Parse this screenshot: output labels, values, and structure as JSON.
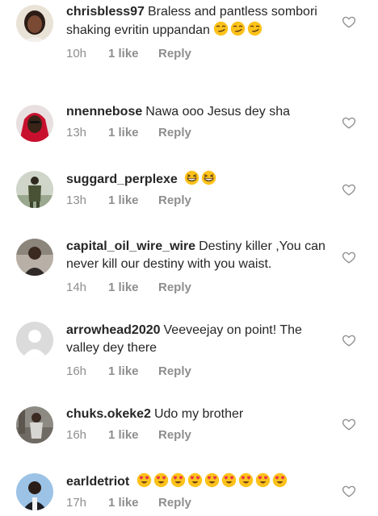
{
  "comments": [
    {
      "username": "chrisbless97",
      "text": "Braless and pantless sombori shaking evritin uppandan",
      "emoji_icon": "smirking-face-icon",
      "emoji_count": 3,
      "time": "10h",
      "likes": "1 like",
      "reply_label": "Reply",
      "avatar_icon": "woman-avatar-icon"
    },
    {
      "username": "nnennebose",
      "text": "Nawa ooo Jesus dey sha",
      "emoji_icon": "",
      "emoji_count": 0,
      "time": "13h",
      "likes": "1 like",
      "reply_label": "Reply",
      "avatar_icon": "woman-red-avatar-icon"
    },
    {
      "username": "suggard_perplexe",
      "text": "",
      "emoji_icon": "grinning-squinting-face-icon",
      "emoji_count": 2,
      "time": "13h",
      "likes": "1 like",
      "reply_label": "Reply",
      "avatar_icon": "soldier-avatar-icon"
    },
    {
      "username": "capital_oil_wire_wire",
      "text": "Destiny killer ,You can never kill our destiny with you waist.",
      "emoji_icon": "",
      "emoji_count": 0,
      "time": "14h",
      "likes": "1 like",
      "reply_label": "Reply",
      "avatar_icon": "man-avatar-icon"
    },
    {
      "username": "arrowhead2020",
      "text": "Veeveejay on point! The valley dey there",
      "emoji_icon": "",
      "emoji_count": 0,
      "time": "16h",
      "likes": "1 like",
      "reply_label": "Reply",
      "avatar_icon": "default-avatar-icon"
    },
    {
      "username": "chuks.okeke2",
      "text": "Udo my brother",
      "emoji_icon": "",
      "emoji_count": 0,
      "time": "16h",
      "likes": "1 like",
      "reply_label": "Reply",
      "avatar_icon": "man-street-avatar-icon"
    },
    {
      "username": "earldetriot",
      "text": "",
      "emoji_icon": "heart-eyes-face-icon",
      "emoji_count": 9,
      "time": "17h",
      "likes": "1 like",
      "reply_label": "Reply",
      "avatar_icon": "man-sky-avatar-icon"
    }
  ],
  "colors": {
    "text": "#262626",
    "meta": "#8e8e8e",
    "emoji_yellow": "#fcc21b",
    "heart_outline": "#8e8e8e"
  }
}
